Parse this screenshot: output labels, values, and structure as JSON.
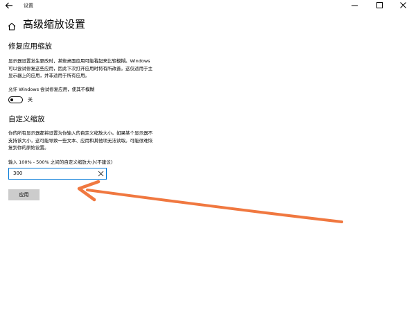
{
  "window": {
    "title": "设置"
  },
  "page": {
    "title": "高级缩放设置"
  },
  "fix_scaling": {
    "heading": "修复应用缩放",
    "description_line1": "显示器设置发生更改时，某些桌面应用可能看起来比较模糊。Windows",
    "description_line2": "可以尝试修复这些应用，因此下次打开应用时将有所改善。这仅适用于主",
    "description_line3": "显示器上的应用，并非适用于所有应用。",
    "toggle_label": "允许 Windows 尝试修复应用，使其不模糊",
    "toggle_state": "关",
    "toggle_on": false
  },
  "custom_scaling": {
    "heading": "自定义缩放",
    "description_line1": "你的所有显示器都将设置为你输入的自定义缩放大小。如果某个显示器不",
    "description_line2": "支持该大小，这可能导致一些文本、应用和其他项无法读取。可能很难恢",
    "description_line3": "复到你的原始设置。",
    "input_label": "输入 100% - 500% 之间的自定义缩放大小(不建议)",
    "input_value": "300",
    "apply_label": "应用"
  },
  "colors": {
    "accent": "#0078d7",
    "annotation_arrow": "#f07840",
    "button_bg": "#cccccc"
  }
}
